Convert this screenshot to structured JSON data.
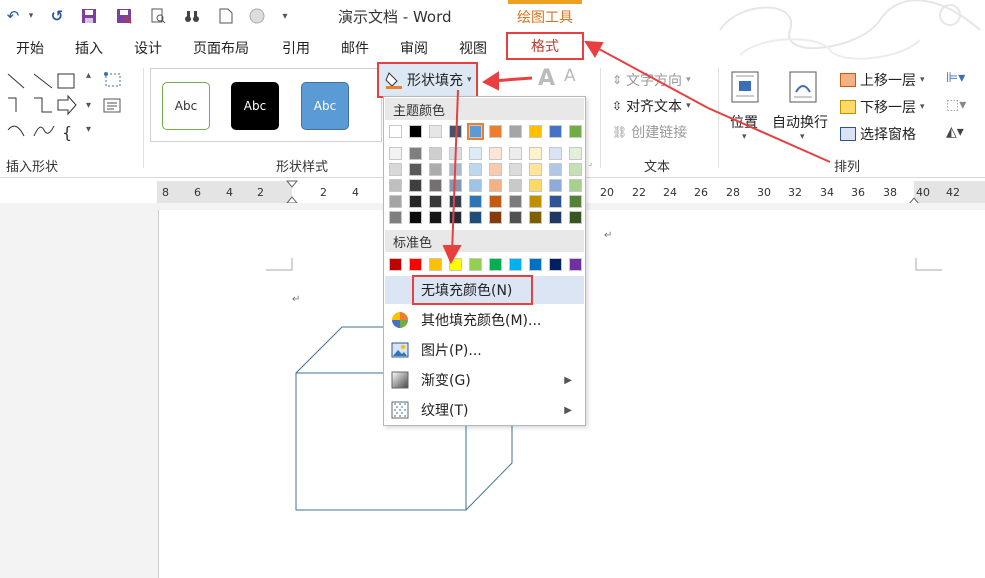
{
  "titlebar": {
    "doc_title": "演示文档 - Word",
    "tool_tab": "绘图工具"
  },
  "qat": {
    "icons": [
      "undo-icon",
      "redo-icon",
      "save-icon",
      "save-as-icon",
      "print-preview-icon",
      "binoculars-icon",
      "new-doc-icon",
      "circle-icon",
      "more-icon"
    ]
  },
  "tabs": [
    "开始",
    "插入",
    "设计",
    "页面布局",
    "引用",
    "邮件",
    "审阅",
    "视图"
  ],
  "format_tab": "格式",
  "ribbon": {
    "insert_shapes_label": "插入形状",
    "shape_styles_label": "形状样式",
    "style_presets": [
      "Abc",
      "Abc",
      "Abc"
    ],
    "fill_button": "形状填充",
    "text_direction": "文字方向",
    "align_text": "对齐文本",
    "create_link": "创建链接",
    "text_group_label": "文本",
    "position": "位置",
    "wrap_text": "自动换行",
    "bring_forward": "上移一层",
    "send_backward": "下移一层",
    "selection_pane": "选择窗格",
    "arrange_label": "排列"
  },
  "ruler": {
    "left_numbers": [
      "8",
      "6",
      "4",
      "2",
      "2",
      "4"
    ],
    "right_numbers": [
      "20",
      "22",
      "24",
      "26",
      "28",
      "30",
      "32",
      "34",
      "36",
      "38",
      "40",
      "42"
    ]
  },
  "dropdown": {
    "theme_colors_header": "主题颜色",
    "standard_colors_header": "标准色",
    "theme_top_row": [
      "#ffffff",
      "#000000",
      "#e7e6e6",
      "#44546a",
      "#5b9bd5",
      "#ed7d31",
      "#a5a5a5",
      "#ffc000",
      "#4472c4",
      "#70ad47"
    ],
    "theme_shades": [
      [
        "#f2f2f2",
        "#7f7f7f",
        "#d0cece",
        "#d6dce4",
        "#deebf6",
        "#fbe5d5",
        "#ededed",
        "#fff2cc",
        "#dae3f3",
        "#e2efd9"
      ],
      [
        "#d8d8d8",
        "#595959",
        "#aeabab",
        "#adb9ca",
        "#bdd7ee",
        "#f7cbac",
        "#dbdbdb",
        "#fee599",
        "#b4c6e7",
        "#c5e0b3"
      ],
      [
        "#bfbfbf",
        "#3f3f3f",
        "#757070",
        "#8496b0",
        "#9dc3e6",
        "#f4b183",
        "#c9c9c9",
        "#ffd965",
        "#8eaadb",
        "#a8d08d"
      ],
      [
        "#a5a5a5",
        "#262626",
        "#3a3838",
        "#323f4f",
        "#2e75b5",
        "#c55a11",
        "#7b7b7b",
        "#bf9000",
        "#2f5496",
        "#538135"
      ],
      [
        "#7f7f7f",
        "#0c0c0c",
        "#171616",
        "#222a35",
        "#1e4e79",
        "#833c0b",
        "#525252",
        "#7f6000",
        "#1f3864",
        "#375623"
      ]
    ],
    "standard_colors": [
      "#c00000",
      "#ff0000",
      "#ffc000",
      "#ffff00",
      "#92d050",
      "#00b050",
      "#00b0f0",
      "#0070c0",
      "#002060",
      "#7030a0"
    ],
    "items": {
      "no_fill": "无填充颜色(N)",
      "more_colors": "其他填充颜色(M)...",
      "picture": "图片(P)...",
      "gradient": "渐变(G)",
      "texture": "纹理(T)"
    }
  },
  "colors": {
    "accent": "#e84040",
    "word_blue": "#2b579a",
    "tool_orange": "#d9731f"
  }
}
